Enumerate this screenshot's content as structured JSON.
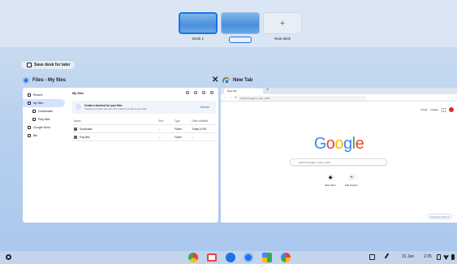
{
  "desks": [
    {
      "label": "Desk 1",
      "active": true
    },
    {
      "label": "",
      "active": false,
      "renaming": true
    }
  ],
  "new_desk": {
    "label": "New desk",
    "icon": "+"
  },
  "save_desk": {
    "label": "Save desk for later"
  },
  "files_window": {
    "title": "Files - My files",
    "close_icon": "✕",
    "sidebar": [
      {
        "label": "Recent",
        "icon": "clock-icon"
      },
      {
        "label": "My files",
        "icon": "computer-icon",
        "active": true
      },
      {
        "label": "Downloads",
        "icon": "download-icon",
        "sub": true
      },
      {
        "label": "Play files",
        "icon": "play-icon",
        "sub": true
      },
      {
        "label": "Google Drive",
        "icon": "drive-icon"
      },
      {
        "label": "Bin",
        "icon": "trash-icon"
      }
    ],
    "header": "My files",
    "banner": {
      "title": "Create a shortcut for your files",
      "subtitle": "Organise your links, and open ‘Pin to shelf’ to pin files to your shelf",
      "action": "Dismiss"
    },
    "columns": {
      "name": "Name",
      "size": "Size",
      "type": "Type",
      "date": "Date modified"
    },
    "rows": [
      {
        "name": "Downloads",
        "size": "--",
        "type": "Folder",
        "date": "Today 10:38"
      },
      {
        "name": "Play files",
        "size": "--",
        "type": "Folder",
        "date": "--"
      }
    ]
  },
  "chrome_window": {
    "title": "New Tab",
    "tab_label": "New Tab",
    "address_placeholder": "Search Google or type a URL",
    "top_links": [
      "Gmail",
      "Images"
    ],
    "logo": [
      "G",
      "o",
      "o",
      "g",
      "l",
      "e"
    ],
    "logo_colors": [
      "#4285f4",
      "#ea4335",
      "#fbbc05",
      "#4285f4",
      "#34a853",
      "#ea4335"
    ],
    "search_placeholder": "Search Google or type a URL",
    "shortcuts": [
      {
        "label": "Web Store",
        "icon": "webstore-icon"
      },
      {
        "label": "Add shortcut",
        "icon": "+"
      }
    ],
    "customize": "Customise Chrome"
  },
  "shelf": {
    "date": "31 Jan",
    "time": "2:35",
    "apps": [
      "chrome",
      "gmail",
      "files",
      "messages",
      "meet",
      "photos"
    ]
  }
}
